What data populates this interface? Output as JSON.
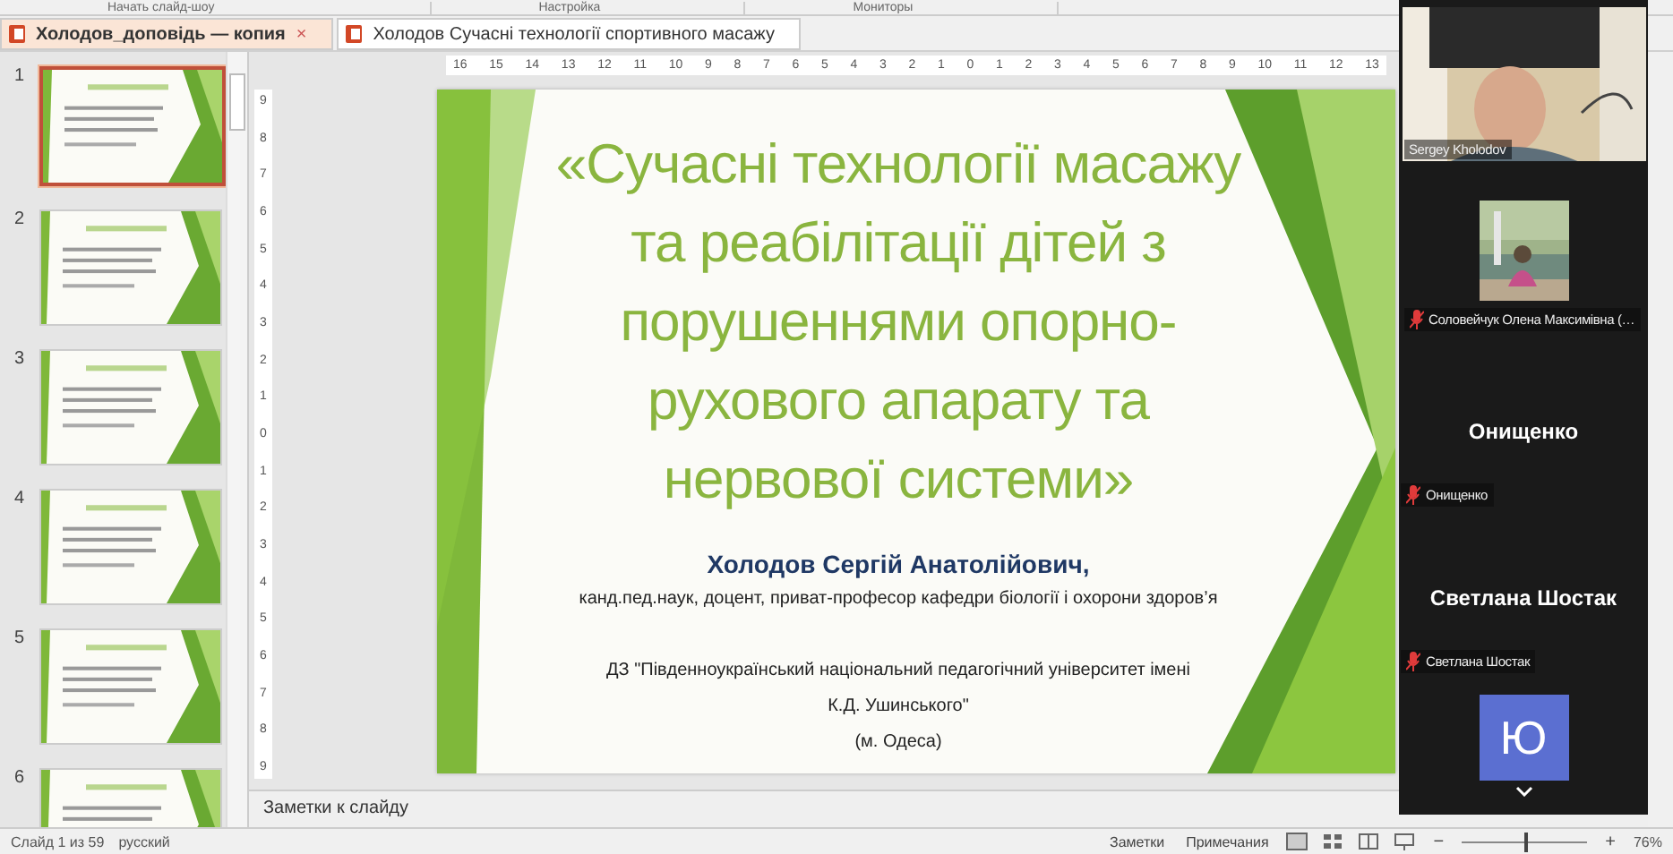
{
  "ribbon_groups": [
    "Начать слайд-шоу",
    "Настройка",
    "Мониторы"
  ],
  "tabs": [
    {
      "label": "Холодов_доповідь — копия",
      "selected": true,
      "close": "×"
    },
    {
      "label": "Холодов  Сучасні  технології  спортивного  масажу",
      "selected": false
    }
  ],
  "thumbnails": [
    {
      "number": "1",
      "selected": true
    },
    {
      "number": "2",
      "selected": false
    },
    {
      "number": "3",
      "selected": false
    },
    {
      "number": "4",
      "selected": false
    },
    {
      "number": "5",
      "selected": false
    },
    {
      "number": "6",
      "selected": false
    }
  ],
  "ruler_labels": [
    "16",
    "15",
    "14",
    "13",
    "12",
    "11",
    "10",
    "9",
    "8",
    "7",
    "6",
    "5",
    "4",
    "3",
    "2",
    "1",
    "0",
    "1",
    "2",
    "3",
    "4",
    "5",
    "6",
    "7",
    "8",
    "9",
    "10",
    "11",
    "12",
    "13"
  ],
  "vertical_ruler_labels": [
    "9",
    "8",
    "7",
    "6",
    "5",
    "4",
    "3",
    "2",
    "1",
    "0",
    "1",
    "2",
    "3",
    "4",
    "5",
    "6",
    "7",
    "8",
    "9"
  ],
  "slide": {
    "title_lines": [
      "«Сучасні технології масажу",
      "та реабілітації дітей з",
      "порушеннями опорно-",
      "рухового апарату та",
      "нервової системи»"
    ],
    "author": "Холодов Сергій Анатолійович,",
    "position": "канд.пед.наук, доцент, приват-професор кафедри біології і охорони здоров’я",
    "institution_lines": [
      "ДЗ \"Південноукраїнський національний педагогічний університет імені",
      "К.Д. Ушинського\""
    ],
    "city": "(м. Одеса)"
  },
  "notes_placeholder": "Заметки к слайду",
  "status_bar": {
    "slide_counter": "Слайд 1 из 59",
    "language": "русский",
    "notes": "Заметки",
    "comments": "Примечания",
    "zoom_out": "−",
    "zoom_in": "+",
    "zoom": "76%",
    "zoom_level": {
      "level": 0.5
    }
  },
  "participants": [
    {
      "kind": "video",
      "name": "Sergey Kholodov",
      "muted": false
    },
    {
      "kind": "video",
      "name": "Соловейчук Олена Максимівна (…",
      "muted": true
    },
    {
      "kind": "name",
      "display": "Онищенко",
      "name": "Онищенко",
      "muted": true
    },
    {
      "kind": "name",
      "display": "Светлана Шостак",
      "name": "Светлана Шостак",
      "muted": true
    },
    {
      "kind": "avatar",
      "initial": "Ю",
      "color": "#5b6fd1"
    }
  ]
}
